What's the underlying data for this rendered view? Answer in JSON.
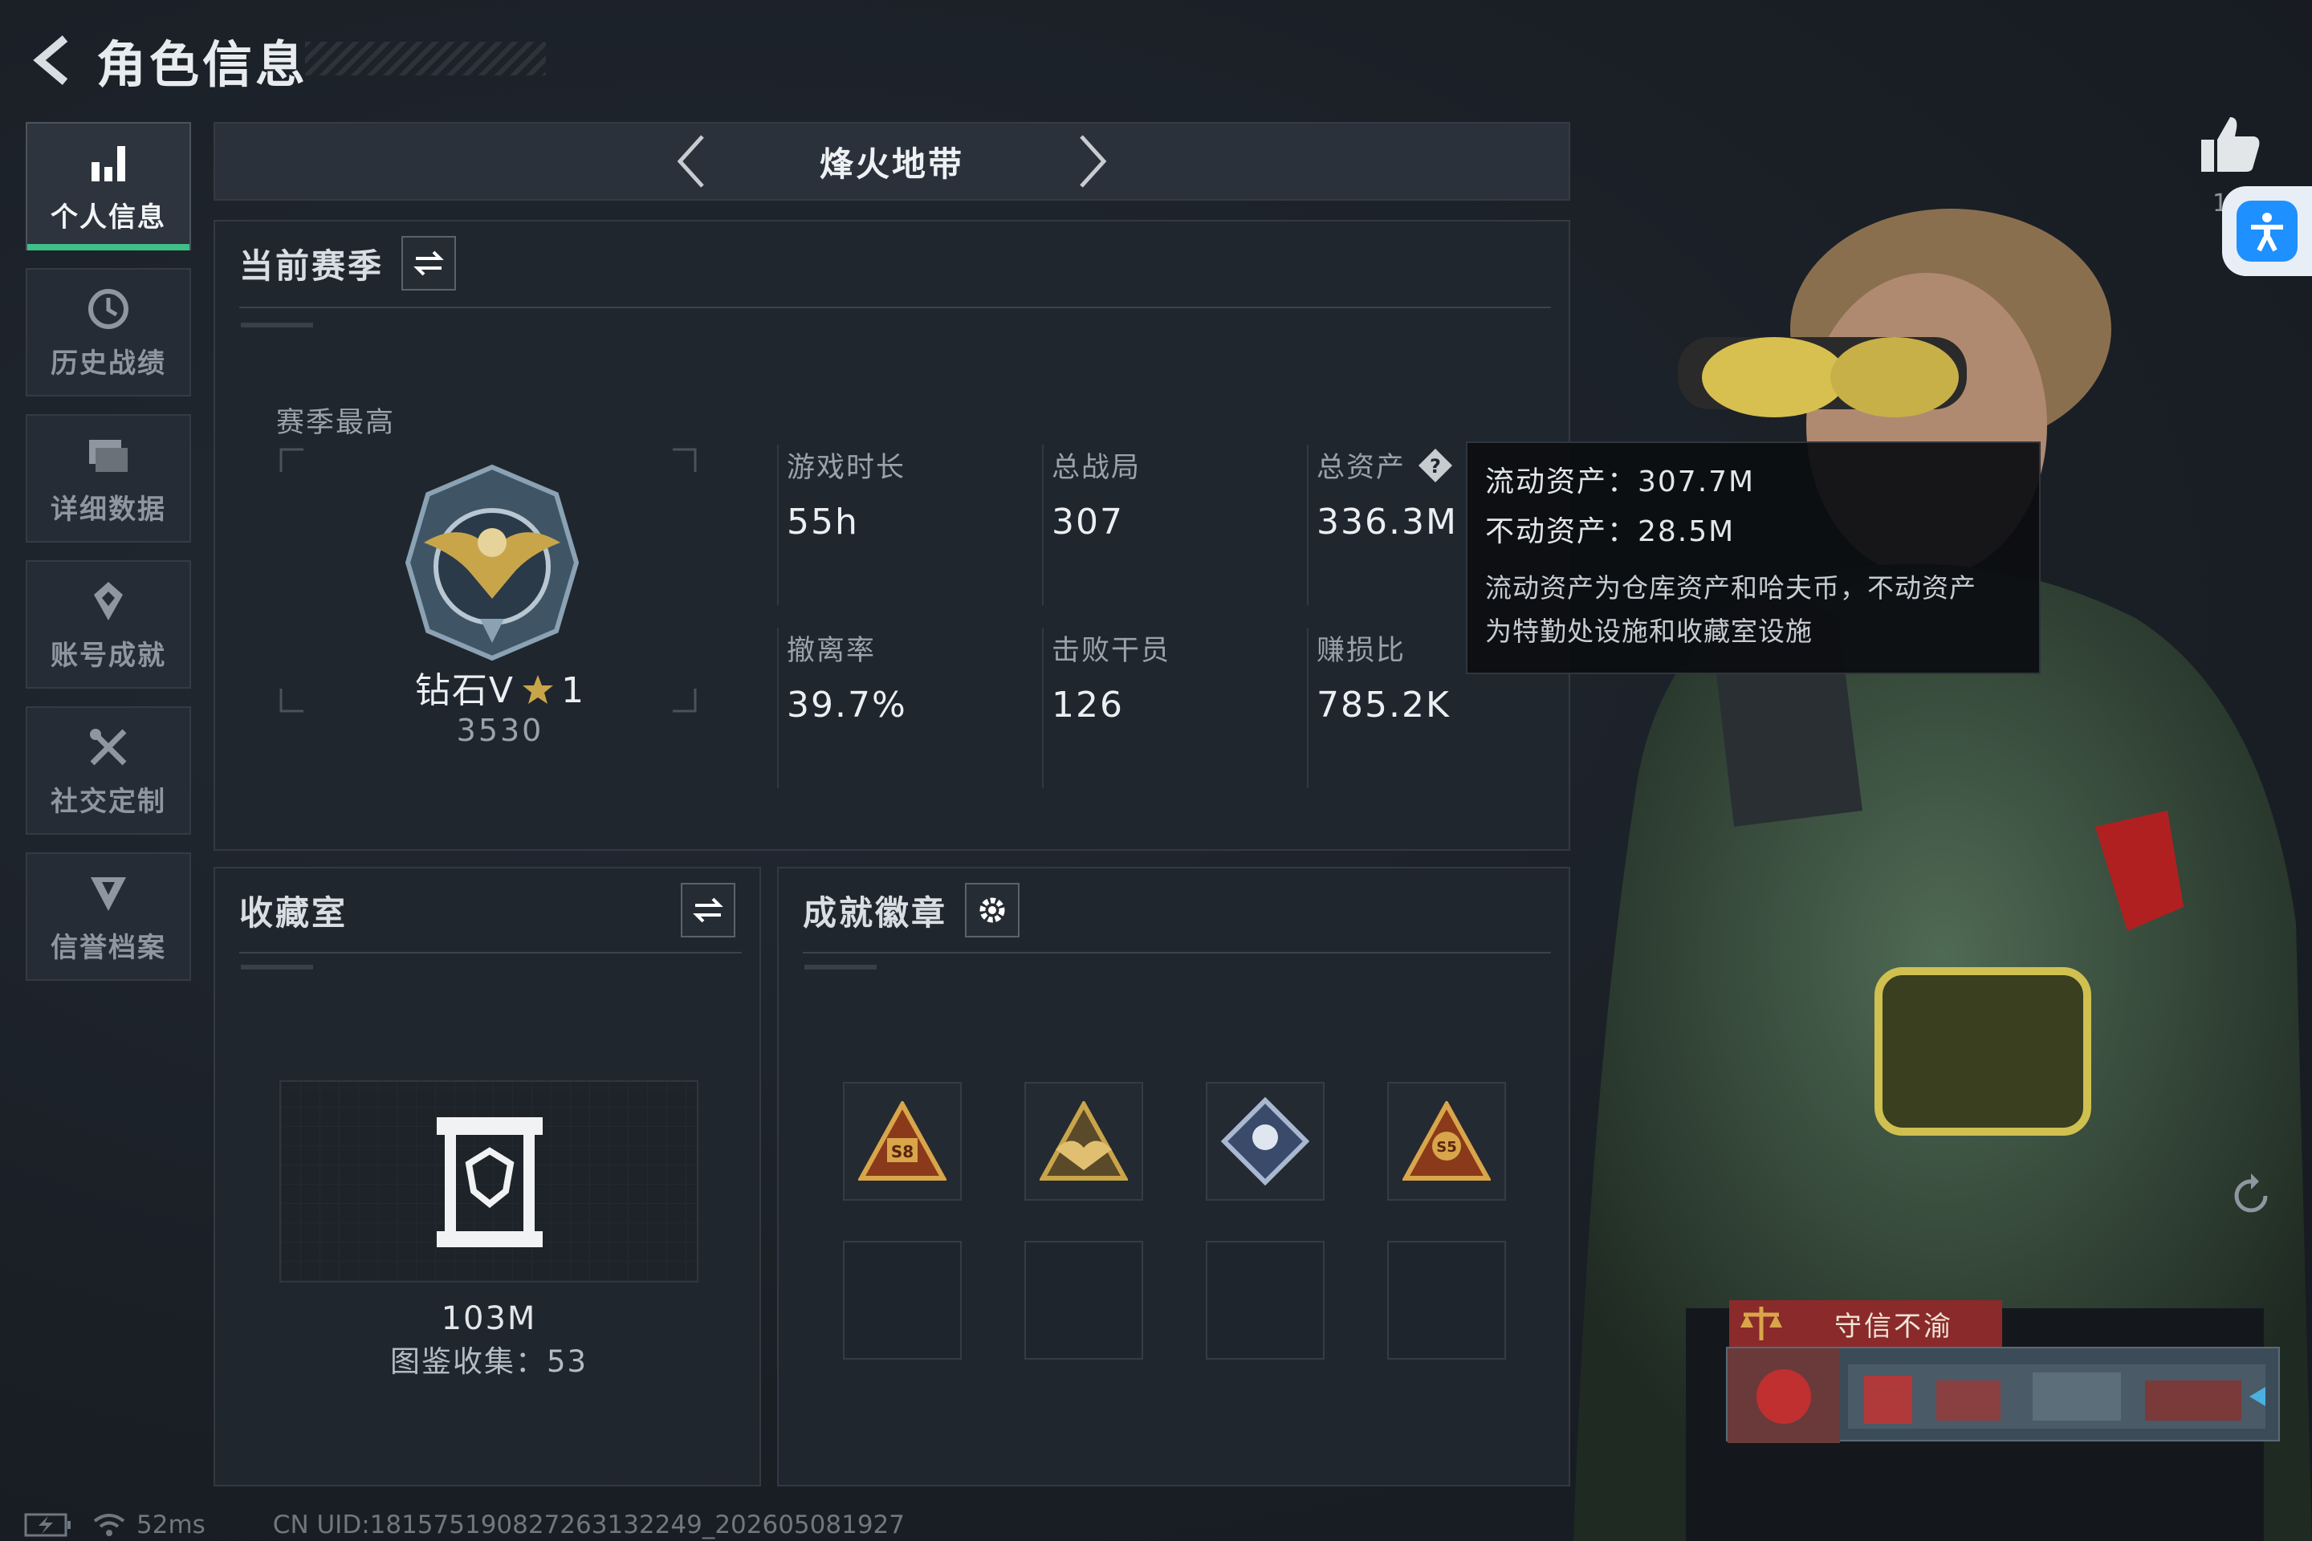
{
  "header": {
    "title": "角色信息"
  },
  "sidebar": {
    "items": [
      {
        "label": "个人信息",
        "icon": "bar-chart-icon",
        "active": true
      },
      {
        "label": "历史战绩",
        "icon": "history-clock-icon",
        "active": false
      },
      {
        "label": "详细数据",
        "icon": "folder-icon",
        "active": false
      },
      {
        "label": "账号成就",
        "icon": "achievement-icon",
        "active": false
      },
      {
        "label": "社交定制",
        "icon": "tools-icon",
        "active": false
      },
      {
        "label": "信誉档案",
        "icon": "shield-icon",
        "active": false
      }
    ]
  },
  "mode": {
    "title": "烽火地带"
  },
  "season": {
    "title": "当前赛季",
    "best_label": "赛季最高",
    "rank_name": "钻石V",
    "rank_stars": "1",
    "rank_points": "3530",
    "stats": [
      {
        "label": "游戏时长",
        "value": "55h"
      },
      {
        "label": "总战局",
        "value": "307"
      },
      {
        "label": "总资产",
        "value": "336.3M"
      },
      {
        "label": "撤离率",
        "value": "39.7%"
      },
      {
        "label": "击败干员",
        "value": "126"
      },
      {
        "label": "赚损比",
        "value": "785.2K"
      }
    ]
  },
  "tooltip": {
    "liquid": "流动资产：307.7M",
    "fixed": "不动资产：28.5M",
    "desc_line1": "流动资产为仓库资产和哈夫币，不动资产",
    "desc_line2": "为特勤处设施和收藏室设施"
  },
  "collection": {
    "title": "收藏室",
    "value": "103M",
    "catalog": "图鉴收集：53"
  },
  "badges": {
    "title": "成就徽章",
    "items": [
      {
        "icon": "s8-badge-icon",
        "label": "S8"
      },
      {
        "icon": "eagle-crest-badge-icon"
      },
      {
        "icon": "diamond-badge-icon"
      },
      {
        "icon": "s5-badge-icon",
        "label": "S5"
      }
    ]
  },
  "right": {
    "like_count": "1",
    "title_banner": "守信不渝"
  },
  "status": {
    "ping": "52ms",
    "uid": "CN UID:1815751908272631322​49_202605081927"
  },
  "colors": {
    "accent": "#3ec088",
    "accessibility": "#1e90ff",
    "banner": "#8a2a2a"
  }
}
